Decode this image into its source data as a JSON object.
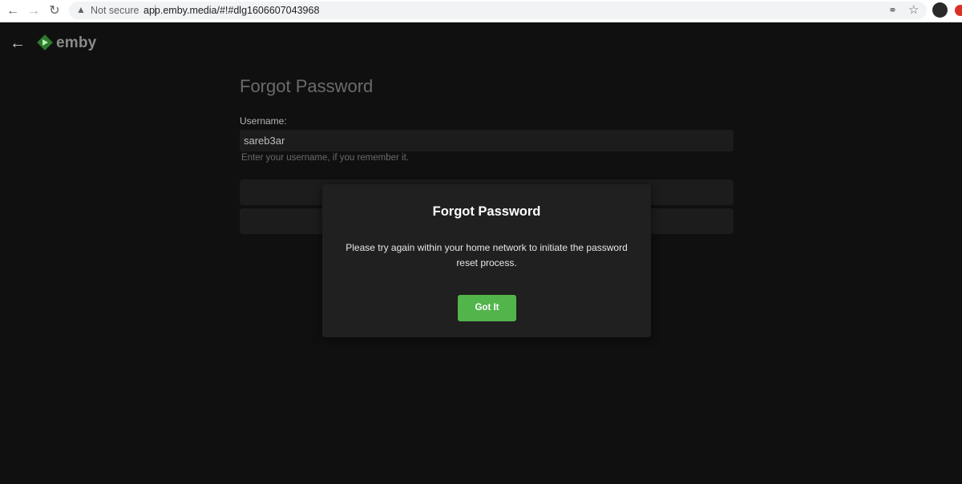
{
  "browser": {
    "security_label": "Not secure",
    "url": "app.emby.media/#!#dlg1606607043968",
    "icons": {
      "back": "arrow-left-icon",
      "forward": "arrow-right-icon",
      "reload": "reload-icon",
      "warning": "warning-icon",
      "key": "key-icon",
      "star": "star-icon"
    }
  },
  "app": {
    "logo_text": "emby",
    "brand_color": "#52b54b"
  },
  "form": {
    "title": "Forgot Password",
    "username_label": "Username:",
    "username_value": "sareb3ar",
    "username_help": "Enter your username, if you remember it."
  },
  "dialog": {
    "title": "Forgot Password",
    "message": "Please try again within your home network to initiate the password reset process.",
    "button_label": "Got It"
  }
}
